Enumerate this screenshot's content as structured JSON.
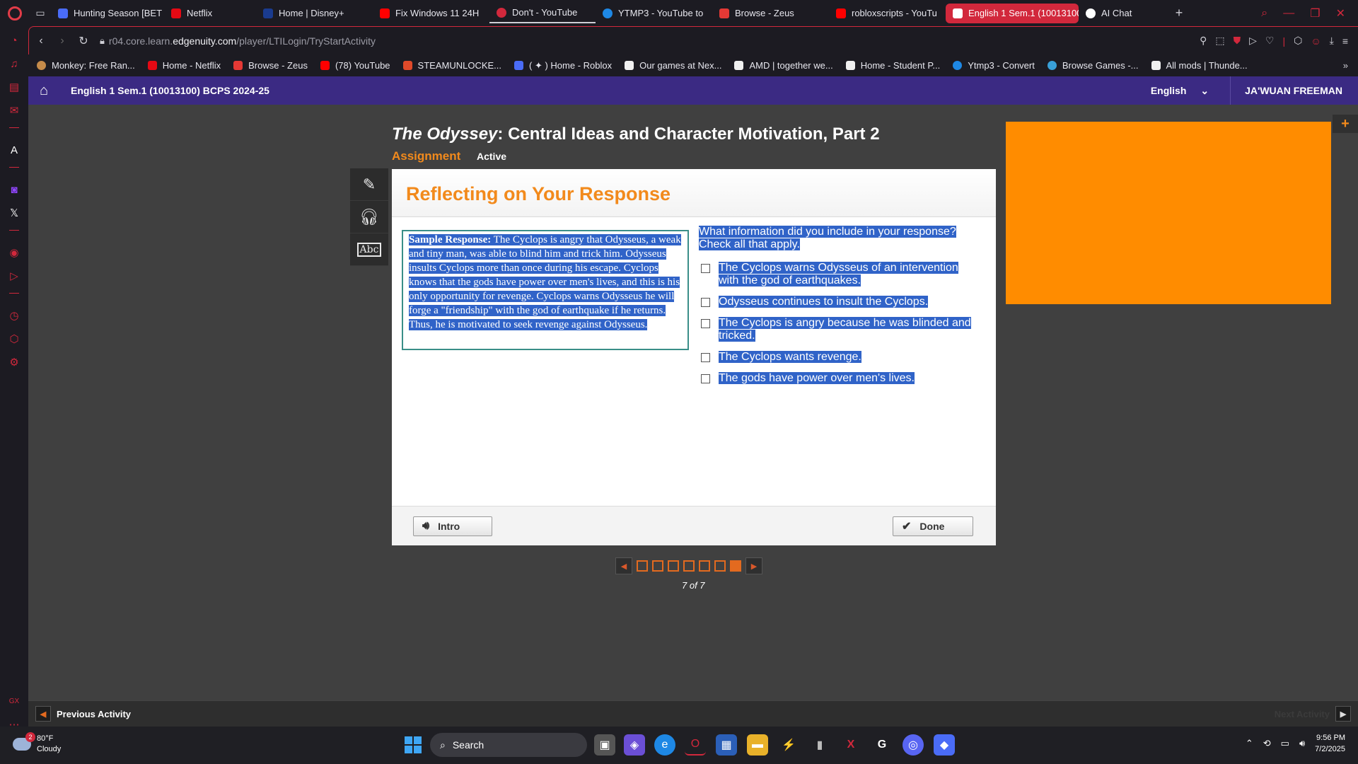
{
  "browser": {
    "tabs": [
      {
        "label": "Hunting Season [BET",
        "color": "#4a6cf7"
      },
      {
        "label": "Netflix",
        "color": "#e50914"
      },
      {
        "label": "Home | Disney+",
        "color": "#1a3b8f"
      },
      {
        "label": "Fix Windows 11 24H",
        "color": "#ff0000"
      },
      {
        "label": "Don't - YouTube",
        "color": "#d2283c"
      },
      {
        "label": "YTMP3 - YouTube to",
        "color": "#1e88e5"
      },
      {
        "label": "Browse - Zeus",
        "color": "#e53935"
      },
      {
        "label": "robloxscripts - YouTu",
        "color": "#ff0000"
      },
      {
        "label": "English 1 Sem.1 (10013100",
        "color": "#ffffff"
      },
      {
        "label": "AI Chat",
        "color": "#ffffff"
      }
    ],
    "url_prefix": "r04.core.learn.",
    "url_domain": "edgenuity.com",
    "url_path": "/player/LTILogin/TryStartActivity",
    "bookmarks": [
      "Monkey: Free Ran...",
      "Home - Netflix",
      "Browse - Zeus",
      "(78) YouTube",
      "STEAMUNLOCKE...",
      "( ✦ ) Home - Roblox",
      "Our games at Nex...",
      "AMD | together we...",
      "Home - Student P...",
      "Ytmp3 - Convert",
      "Browse Games -...",
      "All mods | Thunde..."
    ]
  },
  "header": {
    "course_title": "English 1 Sem.1 (10013100) BCPS 2024-25",
    "language": "English",
    "user_name": "JA'WUAN FREEMAN"
  },
  "activity": {
    "title_italic": "The Odyssey",
    "title_rest": ": Central Ideas and Character Motivation, Part 2",
    "type": "Assignment",
    "status": "Active"
  },
  "panel": {
    "heading": "Reflecting on Your Response",
    "sample_label": "Sample Response:",
    "sample_text": " The Cyclops is angry that Odysseus, a weak and tiny man, was able to blind him and trick him. Odysseus insults Cyclops more than once during his escape. Cyclops knows that the gods have power over men's lives, and this is his only opportunity for revenge. Cyclops warns Odysseus he will forge a \"friendship\" with the god of earthquake if he returns. Thus, he is motivated to seek revenge against Odysseus.",
    "question": "What information did you include in your response? Check all that apply.",
    "choices": [
      "The Cyclops warns Odysseus of an intervention with the god of earthquakes.",
      "Odysseus continues to insult the Cyclops.",
      "The Cyclops is angry because he was blinded and tricked.",
      "The Cyclops wants revenge.",
      "The gods have power over men's lives."
    ],
    "intro_label": "Intro",
    "done_label": "Done"
  },
  "pager": {
    "current": 7,
    "total": 7,
    "label": "7 of 7"
  },
  "footer": {
    "previous_label": "Previous Activity",
    "next_label": "Next Activity"
  },
  "taskbar": {
    "weather_temp": "80°F",
    "weather_desc": "Cloudy",
    "weather_badge": "2",
    "search_label": "Search",
    "time": "9:56 PM",
    "date": "7/2/2025"
  },
  "colors": {
    "accent_orange": "#f28a1c",
    "header_purple": "#3b2a83",
    "selection_blue": "#3063c8",
    "orange_box": "#ff8c00"
  }
}
